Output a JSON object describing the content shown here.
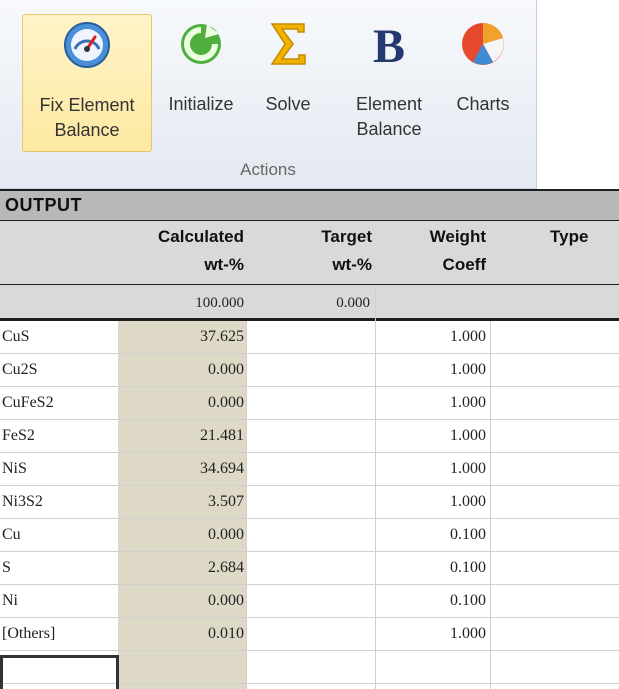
{
  "ribbon": {
    "buttons": [
      {
        "label_line1": "Fix Element",
        "label_line2": "Balance",
        "icon": "gauge-icon"
      },
      {
        "label_line1": "Initialize",
        "label_line2": "",
        "icon": "refresh-icon"
      },
      {
        "label_line1": "Solve",
        "label_line2": "",
        "icon": "sigma-icon"
      },
      {
        "label_line1": "Element",
        "label_line2": "Balance",
        "icon": "bold-b-icon"
      },
      {
        "label_line1": "Charts",
        "label_line2": "",
        "icon": "pie-chart-icon"
      }
    ],
    "group_label": "Actions"
  },
  "sheet": {
    "title": "OUTPUT",
    "headers": {
      "calc_line1": "Calculated",
      "calc_line2": "wt-%",
      "target_line1": "Target",
      "target_line2": "wt-%",
      "weight_line1": "Weight",
      "weight_line2": "Coeff",
      "type_line1": "Type"
    },
    "totals": {
      "calculated": "100.000",
      "target": "0.000"
    },
    "rows": [
      {
        "name": "CuS",
        "calculated": "37.625",
        "target": "",
        "weight": "1.000"
      },
      {
        "name": "Cu2S",
        "calculated": "0.000",
        "target": "",
        "weight": "1.000"
      },
      {
        "name": "CuFeS2",
        "calculated": "0.000",
        "target": "",
        "weight": "1.000"
      },
      {
        "name": "FeS2",
        "calculated": "21.481",
        "target": "",
        "weight": "1.000"
      },
      {
        "name": "NiS",
        "calculated": "34.694",
        "target": "",
        "weight": "1.000"
      },
      {
        "name": "Ni3S2",
        "calculated": "3.507",
        "target": "",
        "weight": "1.000"
      },
      {
        "name": "Cu",
        "calculated": "0.000",
        "target": "",
        "weight": "0.100"
      },
      {
        "name": "S",
        "calculated": "2.684",
        "target": "",
        "weight": "0.100"
      },
      {
        "name": "Ni",
        "calculated": "0.000",
        "target": "",
        "weight": "0.100"
      },
      {
        "name": "[Others]",
        "calculated": "0.010",
        "target": "",
        "weight": "1.000"
      }
    ]
  }
}
